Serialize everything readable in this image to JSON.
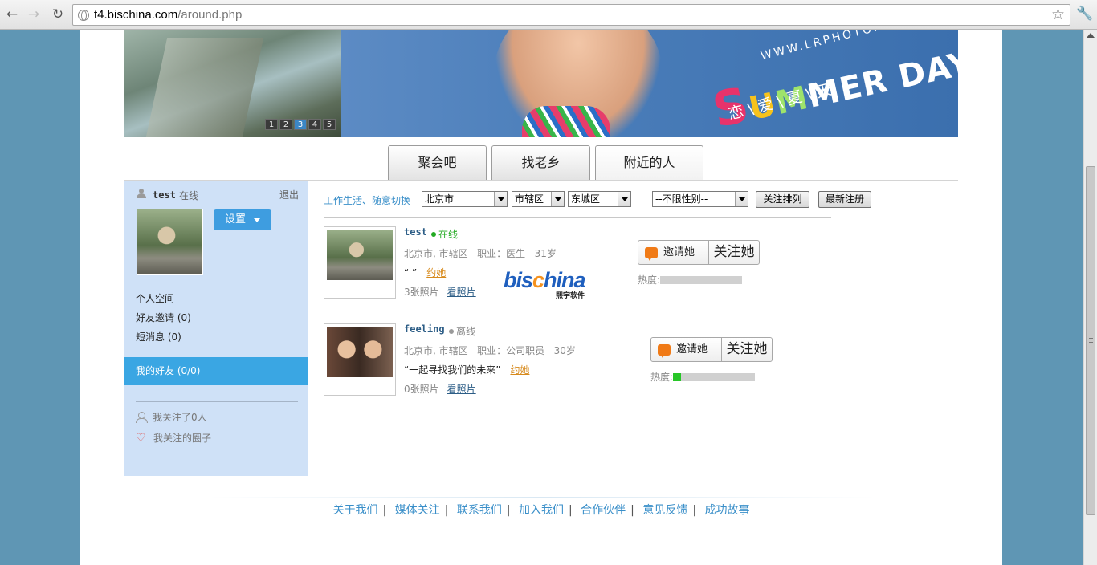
{
  "browser": {
    "url_host": "t4.bischina.com",
    "url_path": "/around.php"
  },
  "banner": {
    "slides": [
      "1",
      "2",
      "3",
      "4",
      "5"
    ],
    "active_slide": "3",
    "headline": "SUMMER DAYS",
    "site_text": "WWW.LRPHOTO.CN",
    "tagline": "恋 \\ 爱 \\ 夏 \\ 天"
  },
  "tabs": [
    {
      "label": "聚会吧"
    },
    {
      "label": "找老乡"
    },
    {
      "label": "附近的人"
    }
  ],
  "sidebar": {
    "username": "test",
    "status": "在线",
    "logout": "退出",
    "settings": "设置",
    "menu": [
      "个人空间",
      "好友邀请 (0)",
      "短消息 (0)"
    ],
    "friends": "我的好友 (0/0)",
    "following_people": "我关注了0人",
    "following_circles": "我关注的圈子"
  },
  "filters": {
    "switch_link": "工作生活、随意切换",
    "city": "北京市",
    "district": "市辖区",
    "area": "东城区",
    "gender": "--不限性别--",
    "sort_follow": "关注排列",
    "sort_newest": "最新注册"
  },
  "results": [
    {
      "name": "test",
      "online": "在线",
      "online_color": "#22aa22",
      "location": "北京市, 市辖区",
      "job_label": "职业：",
      "job": "医生",
      "age": "31岁",
      "quote": "“ ”",
      "date_link": "约她",
      "photo_count": "3张照片",
      "view_photos": "看照片",
      "invite": "邀请她",
      "follow": "关注她",
      "heat_label": "热度:",
      "heat_level": 0
    },
    {
      "name": "feeling",
      "online": "离线",
      "online_color": "#999999",
      "location": "北京市, 市辖区",
      "job_label": "职业：",
      "job": "公司职员",
      "age": "30岁",
      "quote": "“一起寻找我们的未来”",
      "date_link": "约她",
      "photo_count": "0张照片",
      "view_photos": "看照片",
      "invite": "邀请她",
      "follow": "关注她",
      "heat_label": "热度:",
      "heat_level": 0.1
    }
  ],
  "watermark": {
    "brand": "bischina",
    "sub": "熙宇软件"
  },
  "footer": [
    "关于我们",
    "媒体关注",
    "联系我们",
    "加入我们",
    "合作伙伴",
    "意见反馈",
    "成功故事"
  ]
}
